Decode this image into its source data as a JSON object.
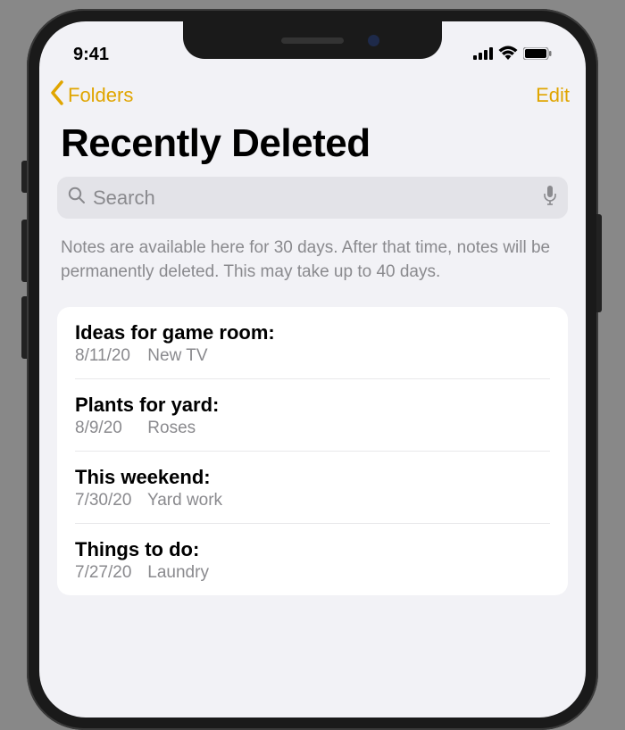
{
  "status": {
    "time": "9:41"
  },
  "nav": {
    "back_label": "Folders",
    "edit_label": "Edit"
  },
  "header": {
    "title": "Recently Deleted"
  },
  "search": {
    "placeholder": "Search"
  },
  "info": {
    "text": "Notes are available here for 30 days. After that time, notes will be permanently deleted. This may take up to 40 days."
  },
  "notes": [
    {
      "title": "Ideas for game room:",
      "date": "8/11/20",
      "preview": "New TV"
    },
    {
      "title": "Plants for yard:",
      "date": "8/9/20",
      "preview": "Roses"
    },
    {
      "title": "This weekend:",
      "date": "7/30/20",
      "preview": "Yard work"
    },
    {
      "title": "Things to do:",
      "date": "7/27/20",
      "preview": "Laundry"
    }
  ],
  "colors": {
    "accent": "#e0a500",
    "bg": "#f2f2f6",
    "secondary_text": "#8a8a8e"
  }
}
